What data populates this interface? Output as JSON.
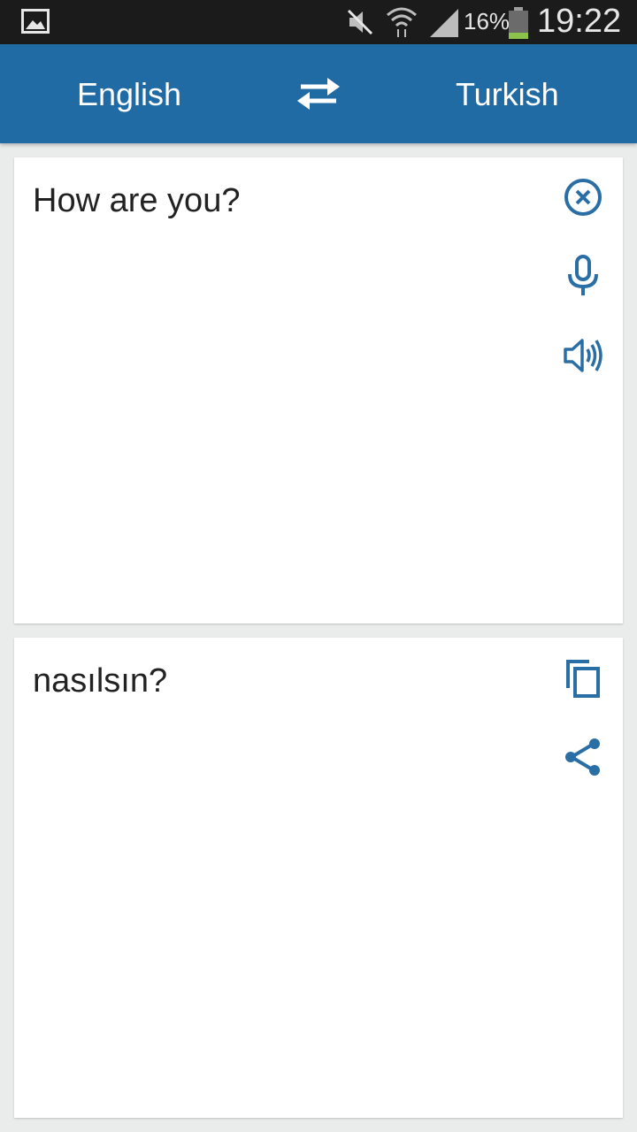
{
  "status_bar": {
    "battery_percent": "16%",
    "time": "19:22",
    "icons": [
      "gallery-icon",
      "mute-icon",
      "wifi-icon",
      "signal-icon",
      "battery-icon"
    ]
  },
  "app_bar": {
    "source_language": "English",
    "target_language": "Turkish",
    "swap_icon": "swap-arrows-icon"
  },
  "input": {
    "text": "How are you?",
    "icons": [
      "clear-icon",
      "microphone-icon",
      "speaker-icon"
    ]
  },
  "output": {
    "text": "nasılsın?",
    "icons": [
      "copy-icon",
      "share-icon"
    ]
  },
  "colors": {
    "accent": "#216ba5",
    "icon": "#2a6ea6",
    "background": "#e9eceb",
    "status_bar": "#1b1b1b"
  }
}
